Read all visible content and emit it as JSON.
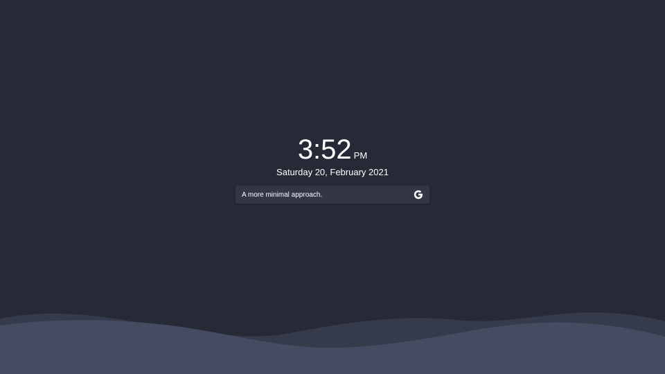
{
  "clock": {
    "time": "3:52",
    "period": "PM"
  },
  "date": {
    "text": "Saturday 20, February 2021"
  },
  "search": {
    "placeholder": "A more minimal approach.",
    "engine_icon": "google-g-icon"
  },
  "colors": {
    "background": "#262a36",
    "search_bg": "#323645",
    "wave_back": "#363b4c",
    "wave_front": "#454b61",
    "text": "#ffffff"
  }
}
